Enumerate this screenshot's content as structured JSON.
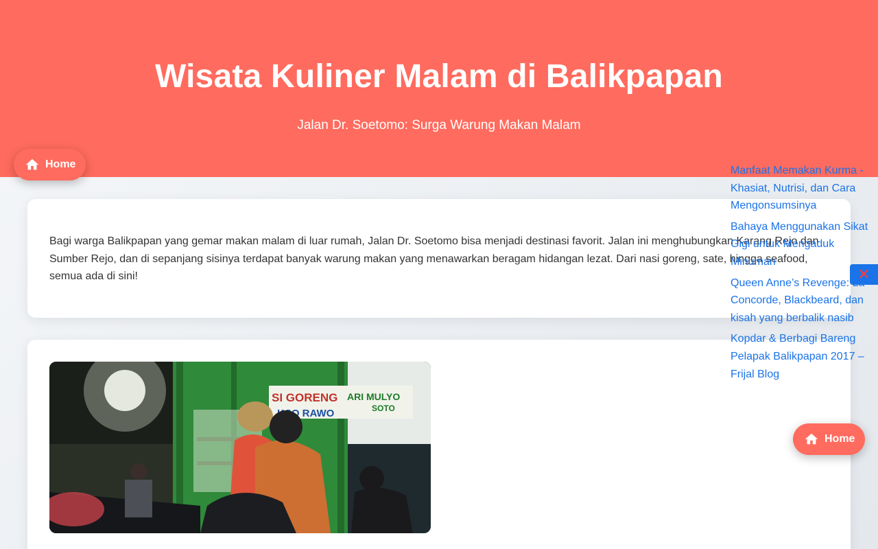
{
  "header": {
    "title": "Wisata Kuliner Malam di Balikpapan",
    "subtitle": "Jalan Dr. Soetomo: Surga Warung Makan Malam"
  },
  "nav": {
    "home_label": "Home",
    "home_label_floating": "Home"
  },
  "content": {
    "intro": "Bagi warga Balikpapan yang gemar makan malam di luar rumah, Jalan Dr. Soetomo bisa menjadi destinasi favorit. Jalan ini menghubungkan Karang Rejo dan Sumber Rejo, dan di sepanjang sisinya terdapat banyak warung makan yang menawarkan beragam hidangan lezat. Dari nasi goreng, sate, hingga seafood, semua ada di sini!"
  },
  "photo": {
    "sign_text_1": "SI GORENG",
    "sign_text_2": "ARI MULYO",
    "sign_text_3": "KSO RAWO",
    "sign_text_4": "SOTO"
  },
  "sidebar": {
    "links": [
      "Manfaat Memakan Kurma - Khasiat, Nutrisi, dan Cara Mengonsumsinya",
      "Bahaya Menggunakan Sikat Gigi untuk Mengaduk Minuman",
      "Queen Anne’s Revenge: La Concorde, Blackbeard, dan kisah yang berbalik nasib",
      "Kopdar & Berbagi Bareng Pelapak Balikpapan 2017 – Frijal Blog"
    ],
    "close_icon": "close-icon"
  },
  "colors": {
    "accent": "#ff6b5e",
    "link": "#1a73e8",
    "close": "#ff3b3b"
  }
}
